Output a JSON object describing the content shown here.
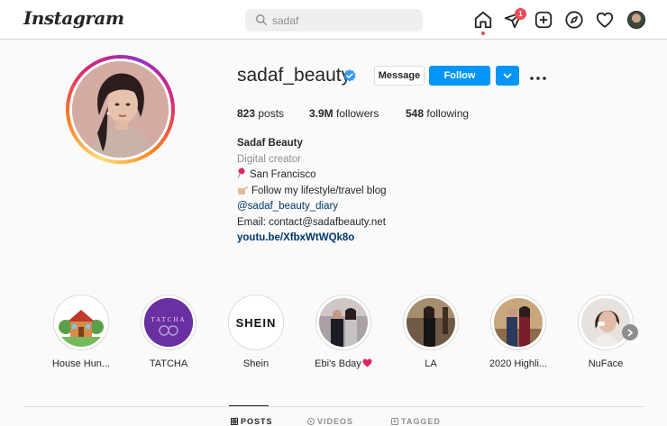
{
  "topbar": {
    "logo": "Instagram",
    "search": {
      "value": "sadaf",
      "icon": "search-icon"
    },
    "notifications_count": "1",
    "icons": [
      "home-icon",
      "direct-message-icon",
      "new-post-icon",
      "explore-icon",
      "activity-heart-icon",
      "profile-avatar"
    ]
  },
  "profile": {
    "username": "sadaf_beauty",
    "verified": true,
    "buttons": {
      "message": "Message",
      "follow": "Follow"
    },
    "stats": {
      "posts_count": "823",
      "posts_label": "posts",
      "followers_count": "3.9M",
      "followers_label": "followers",
      "following_count": "548",
      "following_label": "following"
    },
    "bio": {
      "full_name": "Sadaf Beauty",
      "category": "Digital creator",
      "location": "San Francisco",
      "tagline": "Follow my lifestyle/travel blog",
      "secondary_account": "@sadaf_beauty_diary",
      "email": "Email: contact@sadafbeauty.net",
      "link": "youtu.be/XfbxWtWQk8o"
    }
  },
  "highlights": [
    {
      "label": "House Hun..."
    },
    {
      "label": "TATCHA",
      "inner_text": "TATCHA"
    },
    {
      "label": "Shein",
      "inner_text": "SHEIN"
    },
    {
      "label": "Ebi's Bday"
    },
    {
      "label": "LA"
    },
    {
      "label": "2020 Highli..."
    },
    {
      "label": "NuFace"
    }
  ],
  "tabs": [
    {
      "label": "POSTS",
      "active": true
    },
    {
      "label": "VIDEOS",
      "active": false
    },
    {
      "label": "TAGGED",
      "active": false
    }
  ],
  "colors": {
    "accent": "#0095f6",
    "badge": "#ed4956",
    "link": "#00376b",
    "heart": "#ed4956"
  }
}
